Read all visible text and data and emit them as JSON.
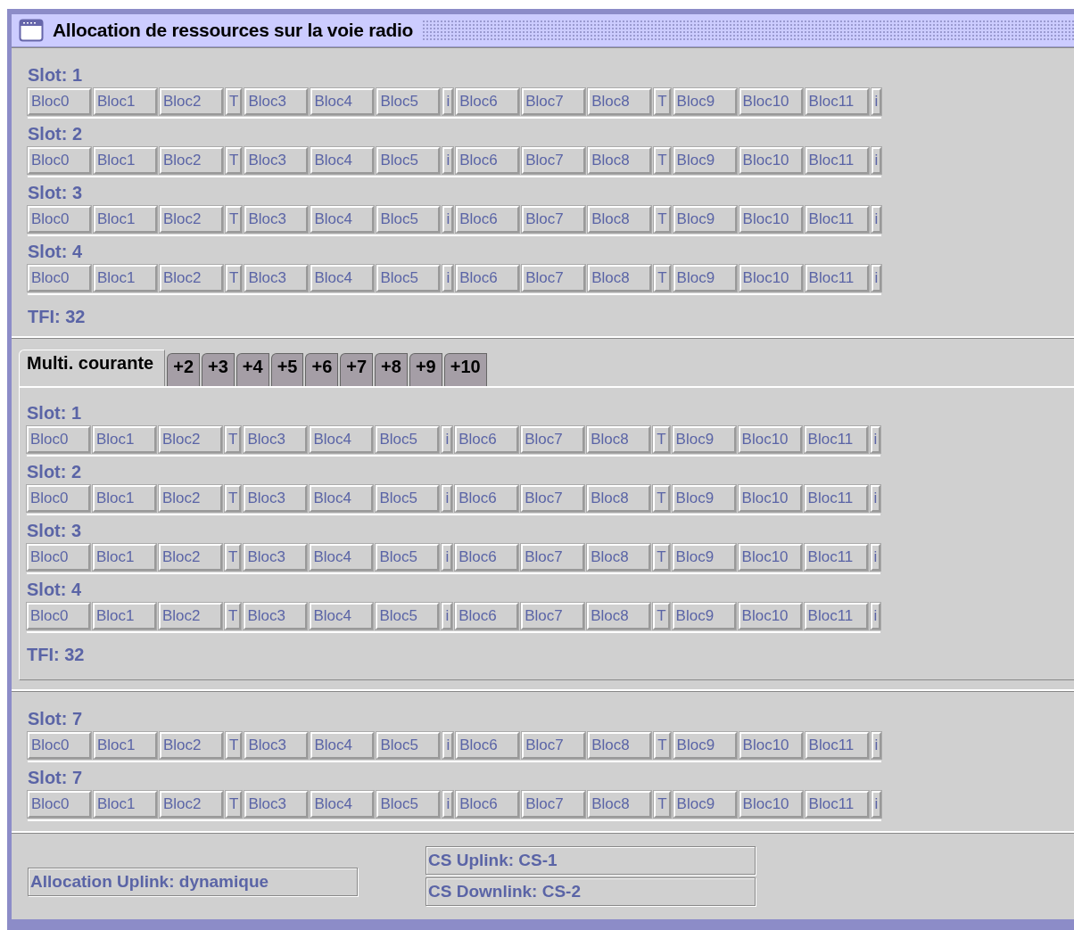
{
  "window": {
    "title": "Allocation de ressources sur la voie radio"
  },
  "panels": [
    {
      "kind": "plain",
      "slots": [
        {
          "label": "Slot: 1",
          "cells": [
            "Bloc0",
            "Bloc1",
            "Bloc2",
            "T",
            "Bloc3",
            "Bloc4",
            "Bloc5",
            "i",
            "Bloc6",
            "Bloc7",
            "Bloc8",
            "T",
            "Bloc9",
            "Bloc10",
            "Bloc11",
            "i"
          ]
        },
        {
          "label": "Slot: 2",
          "cells": [
            "Bloc0",
            "Bloc1",
            "Bloc2",
            "T",
            "Bloc3",
            "Bloc4",
            "Bloc5",
            "i",
            "Bloc6",
            "Bloc7",
            "Bloc8",
            "T",
            "Bloc9",
            "Bloc10",
            "Bloc11",
            "i"
          ]
        },
        {
          "label": "Slot: 3",
          "cells": [
            "Bloc0",
            "Bloc1",
            "Bloc2",
            "T",
            "Bloc3",
            "Bloc4",
            "Bloc5",
            "i",
            "Bloc6",
            "Bloc7",
            "Bloc8",
            "T",
            "Bloc9",
            "Bloc10",
            "Bloc11",
            "i"
          ]
        },
        {
          "label": "Slot: 4",
          "cells": [
            "Bloc0",
            "Bloc1",
            "Bloc2",
            "T",
            "Bloc3",
            "Bloc4",
            "Bloc5",
            "i",
            "Bloc6",
            "Bloc7",
            "Bloc8",
            "T",
            "Bloc9",
            "Bloc10",
            "Bloc11",
            "i"
          ]
        }
      ],
      "tfi": "TFI: 32"
    },
    {
      "kind": "tabbed",
      "tabs": [
        {
          "label": "Multi. courante",
          "selected": true
        },
        {
          "label": "+2",
          "selected": false
        },
        {
          "label": "+3",
          "selected": false
        },
        {
          "label": "+4",
          "selected": false
        },
        {
          "label": "+5",
          "selected": false
        },
        {
          "label": "+6",
          "selected": false
        },
        {
          "label": "+7",
          "selected": false
        },
        {
          "label": "+8",
          "selected": false
        },
        {
          "label": "+9",
          "selected": false
        },
        {
          "label": "+10",
          "selected": false
        }
      ],
      "slots": [
        {
          "label": "Slot: 1",
          "cells": [
            "Bloc0",
            "Bloc1",
            "Bloc2",
            "T",
            "Bloc3",
            "Bloc4",
            "Bloc5",
            "i",
            "Bloc6",
            "Bloc7",
            "Bloc8",
            "T",
            "Bloc9",
            "Bloc10",
            "Bloc11",
            "i"
          ]
        },
        {
          "label": "Slot: 2",
          "cells": [
            "Bloc0",
            "Bloc1",
            "Bloc2",
            "T",
            "Bloc3",
            "Bloc4",
            "Bloc5",
            "i",
            "Bloc6",
            "Bloc7",
            "Bloc8",
            "T",
            "Bloc9",
            "Bloc10",
            "Bloc11",
            "i"
          ]
        },
        {
          "label": "Slot: 3",
          "cells": [
            "Bloc0",
            "Bloc1",
            "Bloc2",
            "T",
            "Bloc3",
            "Bloc4",
            "Bloc5",
            "i",
            "Bloc6",
            "Bloc7",
            "Bloc8",
            "T",
            "Bloc9",
            "Bloc10",
            "Bloc11",
            "i"
          ]
        },
        {
          "label": "Slot: 4",
          "cells": [
            "Bloc0",
            "Bloc1",
            "Bloc2",
            "T",
            "Bloc3",
            "Bloc4",
            "Bloc5",
            "i",
            "Bloc6",
            "Bloc7",
            "Bloc8",
            "T",
            "Bloc9",
            "Bloc10",
            "Bloc11",
            "i"
          ]
        }
      ],
      "tfi": "TFI: 32"
    },
    {
      "kind": "plain",
      "slots": [
        {
          "label": "Slot: 7",
          "cells": [
            "Bloc0",
            "Bloc1",
            "Bloc2",
            "T",
            "Bloc3",
            "Bloc4",
            "Bloc5",
            "i",
            "Bloc6",
            "Bloc7",
            "Bloc8",
            "T",
            "Bloc9",
            "Bloc10",
            "Bloc11",
            "i"
          ]
        },
        {
          "label": "Slot: 7",
          "cells": [
            "Bloc0",
            "Bloc1",
            "Bloc2",
            "T",
            "Bloc3",
            "Bloc4",
            "Bloc5",
            "i",
            "Bloc6",
            "Bloc7",
            "Bloc8",
            "T",
            "Bloc9",
            "Bloc10",
            "Bloc11",
            "i"
          ]
        }
      ]
    }
  ],
  "footer": {
    "allocation": "Allocation Uplink: dynamique",
    "cs_uplink": "CS Uplink: CS-1",
    "cs_downlink": "CS Downlink: CS-2"
  }
}
